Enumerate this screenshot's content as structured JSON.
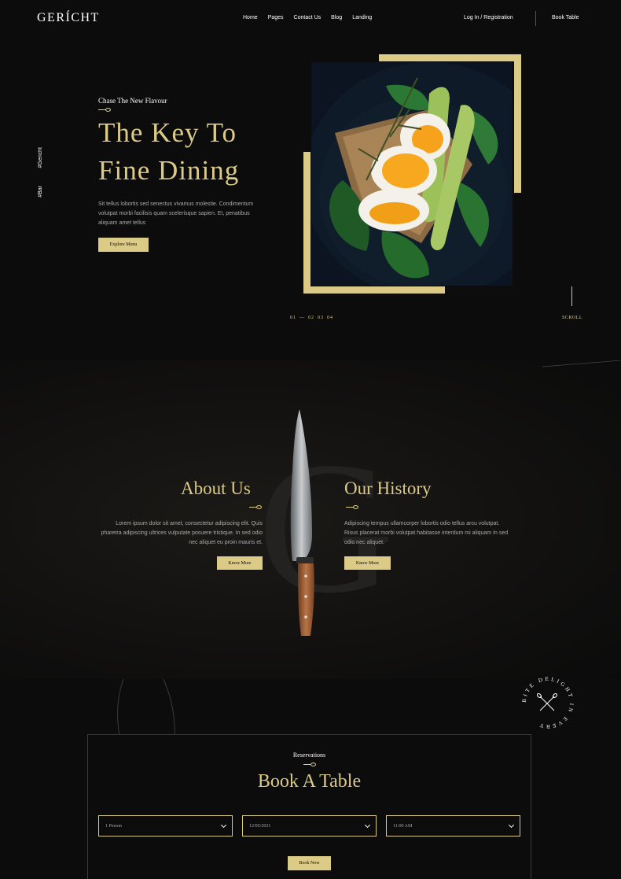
{
  "nav": {
    "logo": "GERÍCHT",
    "links": [
      "Home",
      "Pages",
      "Contact Us",
      "Blog",
      "Landing"
    ],
    "login": "Log In / Registration",
    "book_table": "Book Table"
  },
  "hero": {
    "side_tags": [
      "#Bar",
      "#Gericht"
    ],
    "subtitle": "Chase The New Flavour",
    "title_line1": "The Key To",
    "title_line2": "Fine Dining",
    "text": "Sit tellus lobortis sed senectus vivamus molestie. Condimentum volutpat morbi facilisis quam scelerisque sapien. Et, penatibus aliquam amet tellus",
    "button": "Explore Menu",
    "pager": [
      "01",
      "—",
      "02",
      "03",
      "04"
    ],
    "scroll": "SCROLL"
  },
  "about": {
    "watermark": "G",
    "about_title": "About Us",
    "about_text": "Lorem ipsum dolor sit amet, consectetur adipiscing elit. Quis pharetra adipiscing ultrices vulputate posuere tristique. In sed odio nec aliquet eu proin mauris et.",
    "about_button": "Know More",
    "history_title": "Our History",
    "history_text": "Adipiscing tempus ullamcorper lobortis odio tellus arcu volutpat. Risus placerat morbi volutpat habitasse interdum mi aliquam In sed odio nec aliquet.",
    "history_button": "Know More"
  },
  "badge": {
    "text": "BITE DELIGHT IN EVERY"
  },
  "reservation": {
    "label": "Reservations",
    "title": "Book A Table",
    "persons": "1 Person",
    "date": "12/05/2021",
    "time": "11:00 AM",
    "button": "Book Now"
  },
  "colors": {
    "accent": "#dcca87",
    "background": "#0c0c0c"
  }
}
